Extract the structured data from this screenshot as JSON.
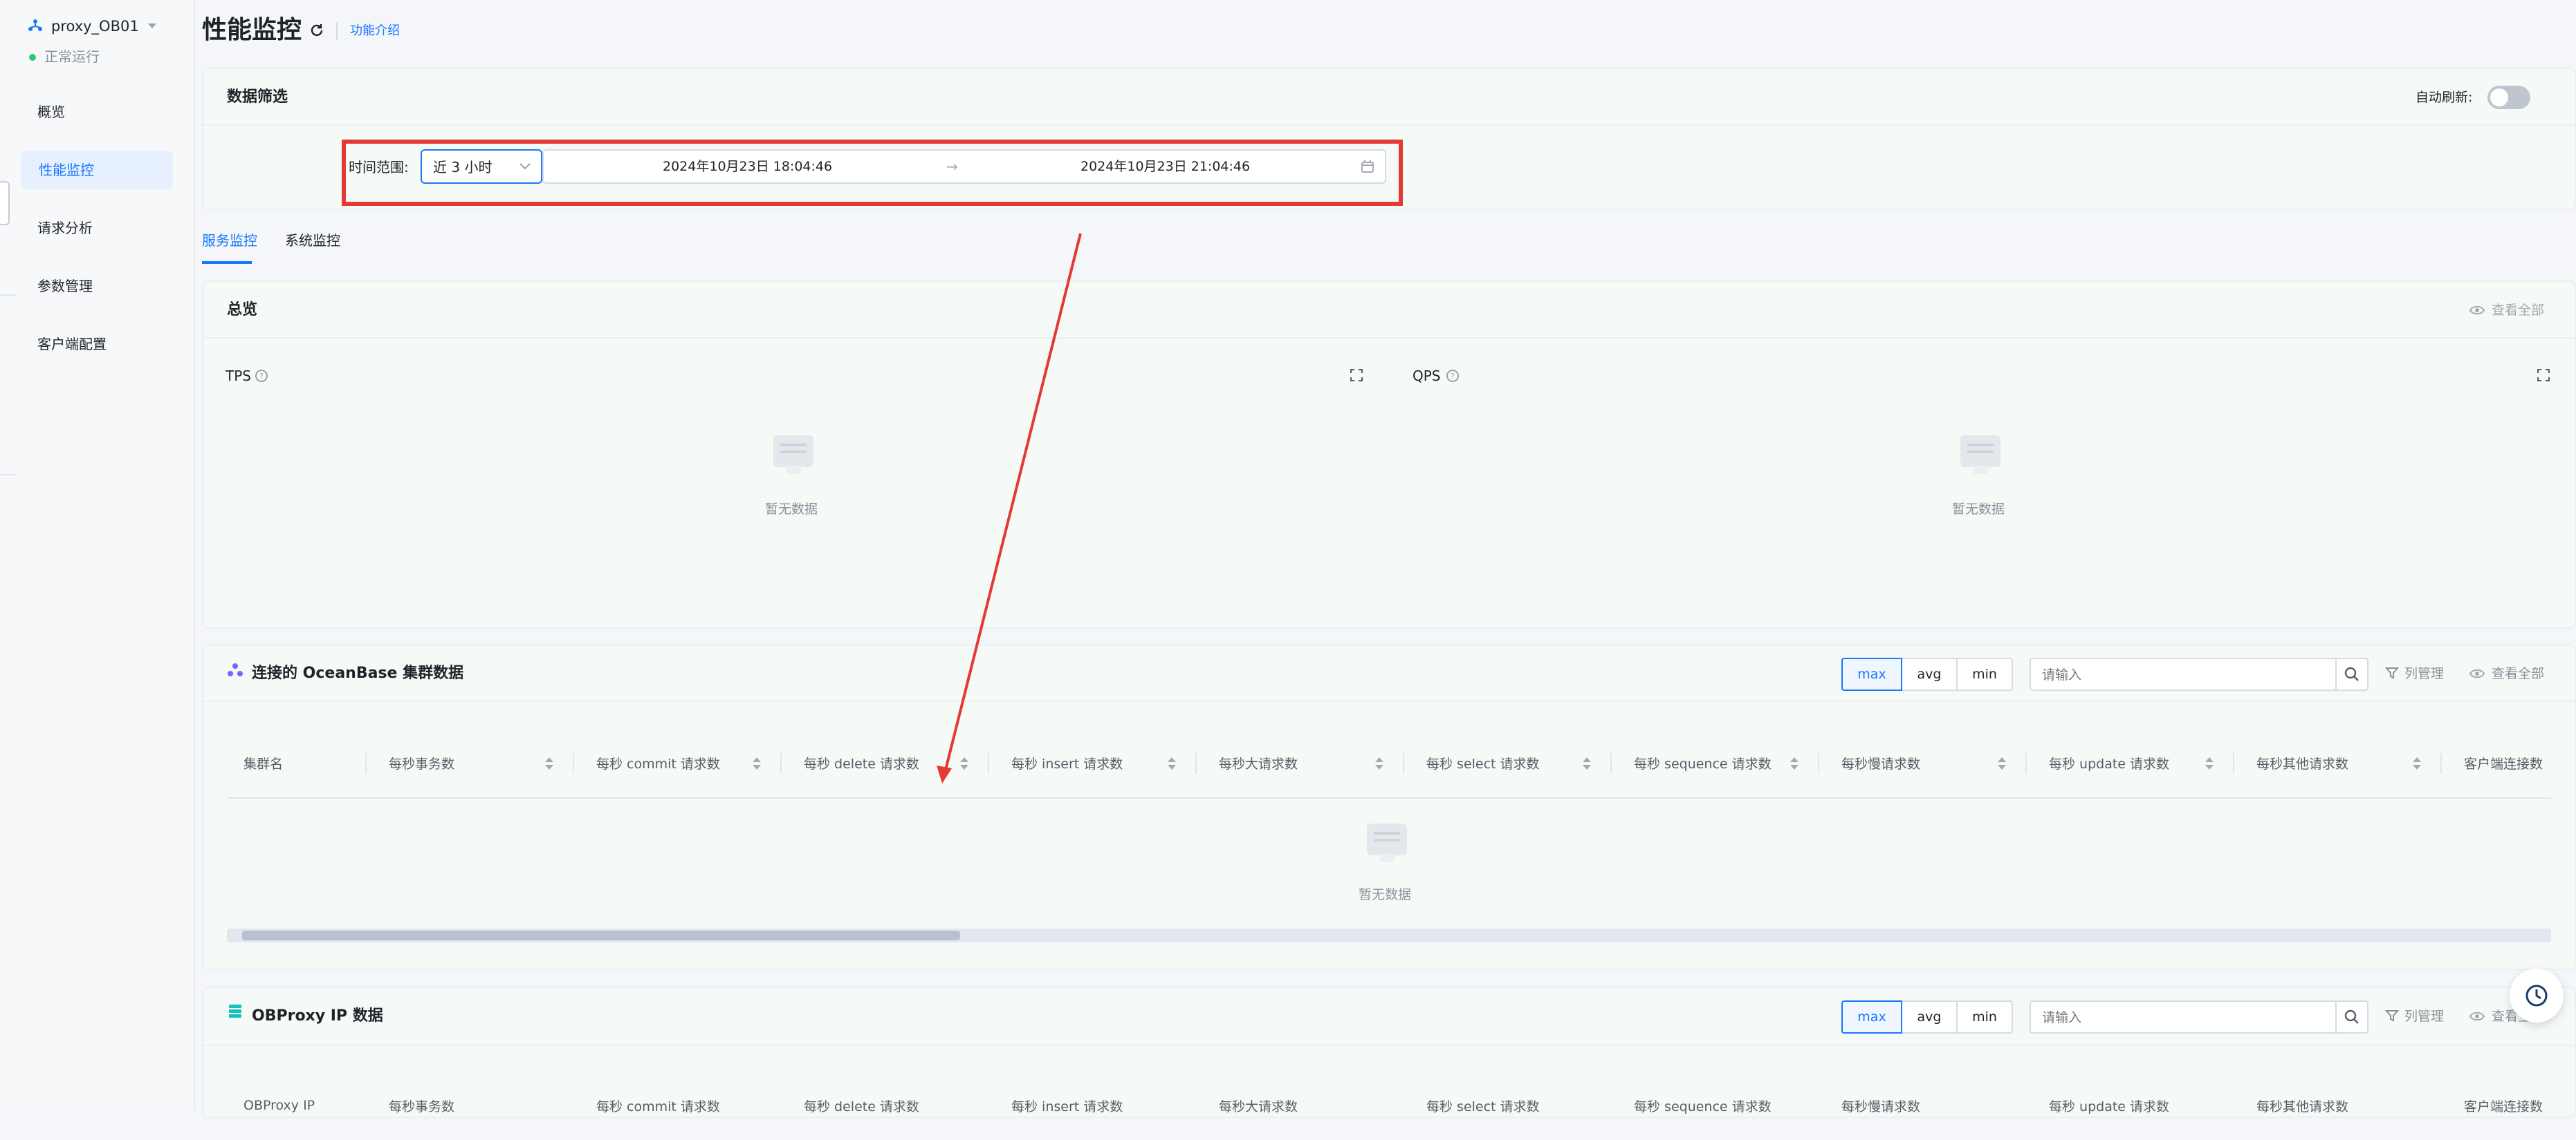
{
  "sidebar": {
    "instance_name": "proxy_OB01",
    "status": "正常运行",
    "status_color": "#2ecc71",
    "items": [
      {
        "label": "概览"
      },
      {
        "label": "性能监控"
      },
      {
        "label": "请求分析"
      },
      {
        "label": "参数管理"
      },
      {
        "label": "客户端配置"
      }
    ]
  },
  "header": {
    "title": "性能监控",
    "intro_link": "功能介绍"
  },
  "filter": {
    "title": "数据筛选",
    "auto_refresh_label": "自动刷新:",
    "auto_refresh_on": false,
    "time_range_label": "时间范围:",
    "time_range_value": "近 3 小时",
    "start_time": "2024年10月23日 18:04:46",
    "end_time": "2024年10月23日 21:04:46",
    "range_separator": "→"
  },
  "tabs": [
    {
      "label": "服务监控",
      "active": true
    },
    {
      "label": "系统监控",
      "active": false
    }
  ],
  "overview": {
    "title": "总览",
    "view_all": "查看全部",
    "charts": [
      {
        "title": "TPS",
        "empty": "暂无数据"
      },
      {
        "title": "QPS",
        "empty": "暂无数据"
      }
    ]
  },
  "cluster_table": {
    "title": "连接的 OceanBase 集群数据",
    "agg": [
      "max",
      "avg",
      "min"
    ],
    "active_agg": "max",
    "search_placeholder": "请输入",
    "column_manage": "列管理",
    "view_all": "查看全部",
    "columns": [
      "集群名",
      "每秒事务数",
      "每秒 commit 请求数",
      "每秒 delete 请求数",
      "每秒 insert 请求数",
      "每秒大请求数",
      "每秒 select 请求数",
      "每秒 sequence 请求数",
      "每秒慢请求数",
      "每秒 update 请求数",
      "每秒其他请求数",
      "客户端连接数"
    ],
    "empty": "暂无数据"
  },
  "ip_table": {
    "title": "OBProxy IP 数据",
    "agg": [
      "max",
      "avg",
      "min"
    ],
    "active_agg": "max",
    "search_placeholder": "请输入",
    "column_manage": "列管理",
    "view_all": "查看全",
    "columns": [
      "OBProxy IP",
      "每秒事务数",
      "每秒 commit 请求数",
      "每秒 delete 请求数",
      "每秒 insert 请求数",
      "每秒大请求数",
      "每秒 select 请求数",
      "每秒 sequence 请求数",
      "每秒慢请求数",
      "每秒 update 请求数",
      "每秒其他请求数",
      "客户端连接数"
    ]
  },
  "colors": {
    "accent": "#1677ff",
    "annotation": "#e53935"
  }
}
